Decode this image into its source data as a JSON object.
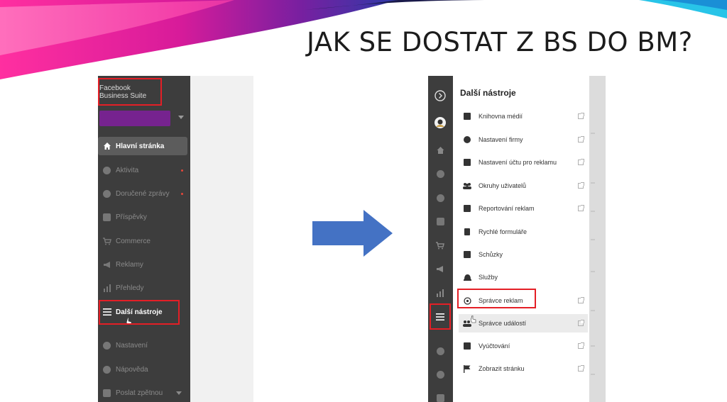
{
  "slide": {
    "title": "JAK SE DOSTAT Z BS DO BM?"
  },
  "left_screenshot": {
    "brand_line1": "Facebook",
    "brand_line2": "Business Suite",
    "nav": [
      {
        "label": "Hlavní stránka",
        "icon": "home-icon",
        "active": true
      },
      {
        "label": "Aktivita",
        "icon": "activity-icon",
        "notify": true
      },
      {
        "label": "Doručené zprávy",
        "icon": "messages-icon",
        "notify": true
      },
      {
        "label": "Příspěvky",
        "icon": "posts-icon"
      },
      {
        "label": "Commerce",
        "icon": "cart-icon"
      },
      {
        "label": "Reklamy",
        "icon": "megaphone-icon"
      },
      {
        "label": "Přehledy",
        "icon": "chart-icon"
      },
      {
        "label": "Další nástroje",
        "icon": "menu-icon",
        "highlighted": true
      },
      {
        "label": "Nastavení",
        "icon": "gear-icon"
      },
      {
        "label": "Nápověda",
        "icon": "help-icon"
      },
      {
        "label": "Poslat zpětnou",
        "icon": "feedback-icon"
      }
    ]
  },
  "right_screenshot": {
    "panel_title": "Další nástroje",
    "tools": [
      {
        "label": "Knihovna médií",
        "icon": "media-library-icon",
        "external": true
      },
      {
        "label": "Nastavení firmy",
        "icon": "gear-icon",
        "external": true
      },
      {
        "label": "Nastavení účtu pro reklamu",
        "icon": "ad-account-icon",
        "external": true
      },
      {
        "label": "Okruhy uživatelů",
        "icon": "audiences-icon",
        "external": true
      },
      {
        "label": "Reportování reklam",
        "icon": "reporting-icon",
        "external": true
      },
      {
        "label": "Rychlé formuláře",
        "icon": "form-icon",
        "external": false
      },
      {
        "label": "Schůzky",
        "icon": "calendar-icon",
        "external": false
      },
      {
        "label": "Služby",
        "icon": "bell-icon",
        "external": false
      },
      {
        "label": "Správce reklam",
        "icon": "ads-manager-icon",
        "external": true,
        "highlighted": true
      },
      {
        "label": "Správce událostí",
        "icon": "events-manager-icon",
        "external": true,
        "hovered": true
      },
      {
        "label": "Vyúčtování",
        "icon": "billing-icon",
        "external": true
      },
      {
        "label": "Zobrazit stránku",
        "icon": "flag-icon",
        "external": true
      }
    ]
  },
  "colors": {
    "highlight_red": "#e41f26",
    "arrow_blue": "#4472c4",
    "sidebar_dark": "#3d3d3d"
  }
}
